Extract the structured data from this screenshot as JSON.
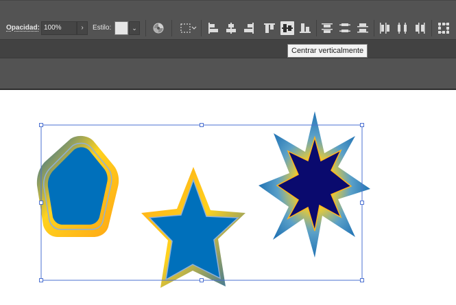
{
  "control_bar": {
    "opacity_label": "Opacidad:",
    "opacity_value": "100%",
    "opacity_arrow": "›",
    "style_label": "Estilo:",
    "style_dropdown": "⌄",
    "icons": {
      "recolor": "recolor-artwork-icon",
      "align_to": "align-to-selection-icon",
      "align_left": "align-left-icon",
      "align_hcenter": "horizontal-align-center-icon",
      "align_right": "align-right-icon",
      "align_top": "vertical-align-top-icon",
      "align_vcenter": "vertical-align-center-icon",
      "align_bottom": "vertical-align-bottom-icon",
      "dist_top": "distribute-top-icon",
      "dist_vcenter": "distribute-vertical-center-icon",
      "dist_bottom": "distribute-bottom-icon",
      "dist_left": "distribute-left-icon",
      "dist_hcenter": "distribute-horizontal-center-icon",
      "dist_right": "distribute-right-icon",
      "transform": "transform-icon"
    }
  },
  "tooltip": {
    "text": "Centrar verticalmente"
  },
  "colors": {
    "panel": "#535353",
    "panel_dark": "#424242",
    "selection": "#4a6fd0",
    "fill_blue": "#0070bb",
    "fill_navy": "#0a0a6e",
    "stroke_orange": "#ffa514",
    "stroke_yellow": "#ffd21e"
  }
}
